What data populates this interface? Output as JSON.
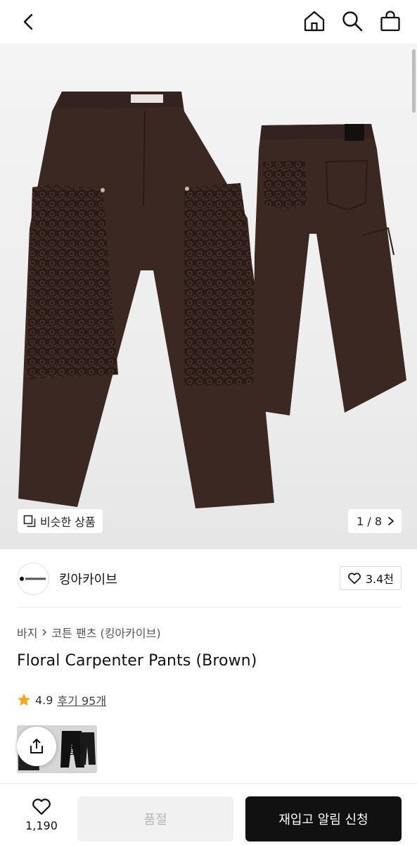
{
  "header": {
    "back_icon": "chevron-left-icon",
    "home_icon": "home-icon",
    "search_icon": "search-icon",
    "bag_icon": "shopping-bag-icon"
  },
  "gallery": {
    "similar_label": "비슷한 상품",
    "pager": "1 / 8",
    "image_subject": "brown carpenter pants with floral lace panels"
  },
  "store": {
    "name": "킹아카이브",
    "likes": "3.4천"
  },
  "product": {
    "breadcrumb": [
      "바지",
      "코튼 팬츠 (킹아카이브)"
    ],
    "title": "Floral Carpenter Pants (Brown)",
    "rating": "4.9",
    "reviews": "후기 95개",
    "option_status": "품절"
  },
  "bottom_bar": {
    "wish_count": "1,190",
    "soldout_label": "품절",
    "restock_label": "재입고 알림 신청"
  },
  "colors": {
    "accent": "#111111",
    "star": "#f5a623",
    "pants": "#3b2823",
    "lace": "#2a1b18"
  }
}
